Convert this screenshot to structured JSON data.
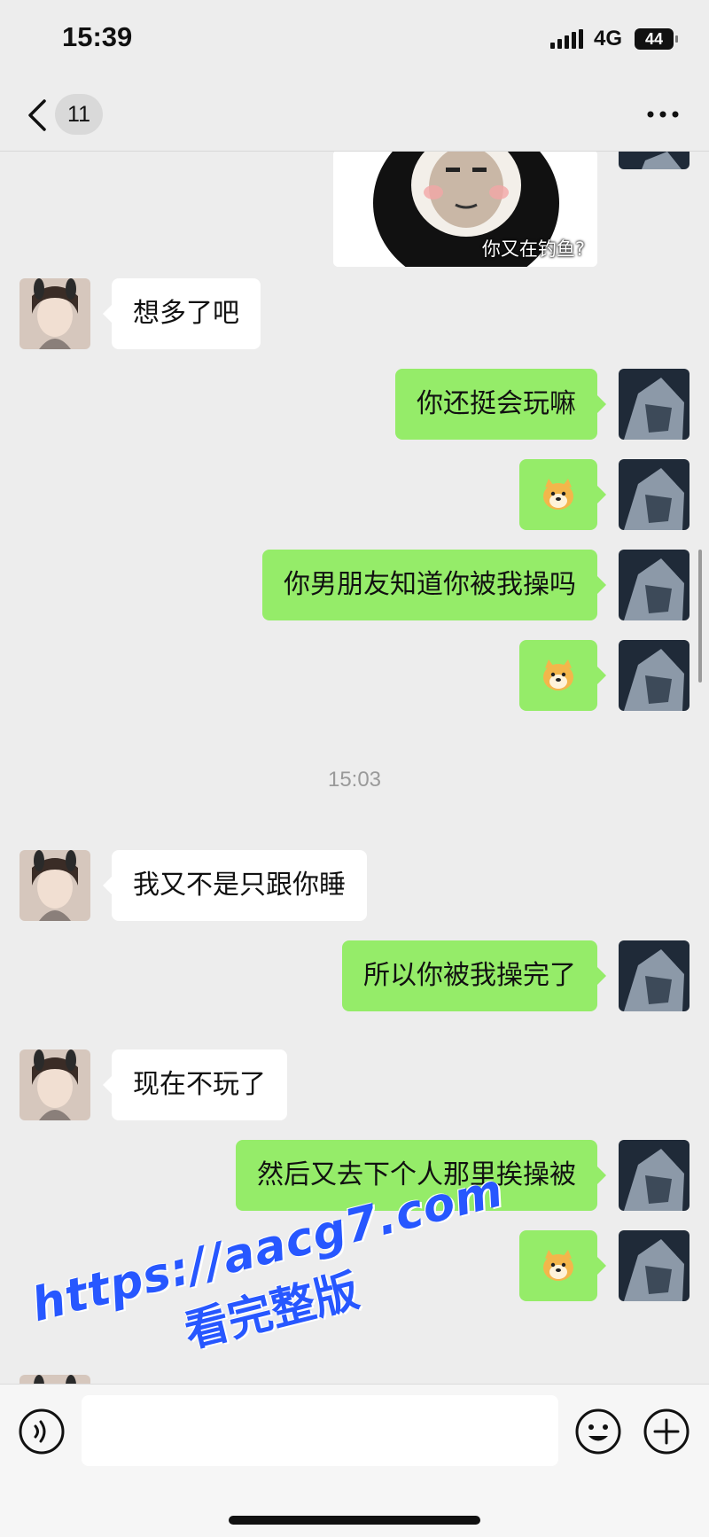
{
  "status_bar": {
    "time": "15:39",
    "network": "4G",
    "battery": "44"
  },
  "nav": {
    "unread_count": "11"
  },
  "sticker": {
    "caption": "你又在钓鱼?"
  },
  "messages": [
    {
      "side": "left",
      "text": "想多了吧"
    },
    {
      "side": "right",
      "text": "你还挺会玩嘛"
    },
    {
      "side": "right",
      "emoji": "doge"
    },
    {
      "side": "right",
      "text": "你男朋友知道你被我操吗"
    },
    {
      "side": "right",
      "emoji": "doge"
    },
    {
      "timestamp": "15:03"
    },
    {
      "side": "left",
      "text": "我又不是只跟你睡"
    },
    {
      "side": "right",
      "text": "所以你被我操完了"
    },
    {
      "side": "left",
      "text": "现在不玩了"
    },
    {
      "side": "right",
      "text": "然后又去下个人那里挨操被"
    },
    {
      "side": "right",
      "emoji": "doge"
    }
  ],
  "watermark": {
    "url": "https://aacg7.com",
    "text": "看完整版"
  },
  "colors": {
    "self_bubble": "#95ec69",
    "other_bubble": "#ffffff",
    "background": "#ededed"
  }
}
